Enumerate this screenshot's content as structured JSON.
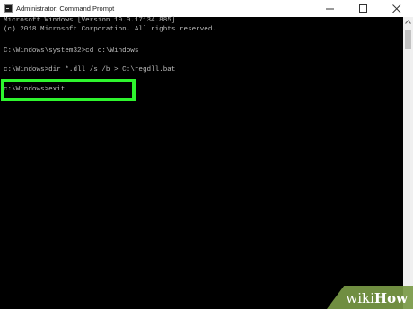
{
  "window": {
    "title": "Administrator: Command Prompt",
    "icon": "cmd-icon",
    "controls": [
      "minimize-icon",
      "maximize-icon",
      "close-icon"
    ]
  },
  "console": {
    "lines": [
      "Microsoft Windows [Version 10.0.17134.885]",
      "(c) 2018 Microsoft Corporation. All rights reserved.",
      "",
      "C:\\Windows\\system32>cd c:\\Windows",
      "",
      "c:\\Windows>dir *.dll /s /b > C:\\regdll.bat",
      "",
      "c:\\Windows>exit"
    ]
  },
  "highlight": {
    "color": "#2ef52e",
    "target": "c:\\Windows>exit"
  },
  "watermark": {
    "brand_wiki": "wiki",
    "brand_how": "How",
    "color": "#7a9a46"
  },
  "colors": {
    "console_bg": "#000000",
    "console_text": "#bcbcbc",
    "titlebar_bg": "#ffffff"
  }
}
